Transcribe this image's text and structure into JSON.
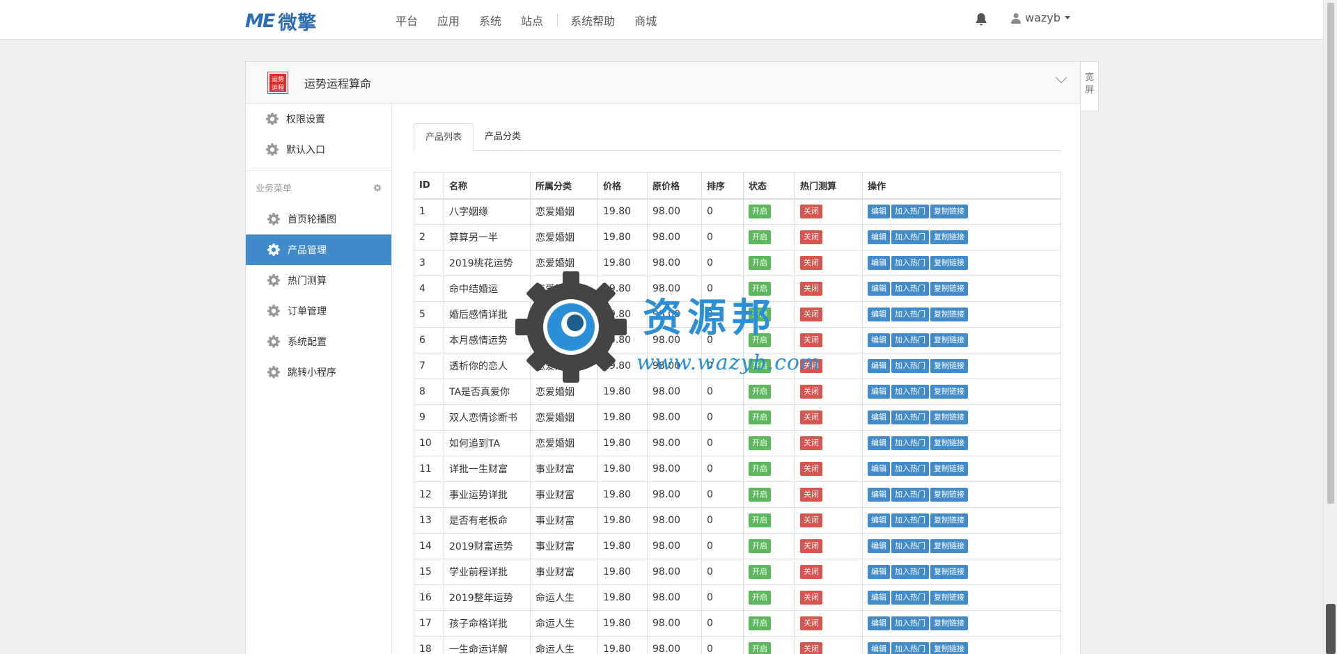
{
  "brand": {
    "mark": "ME",
    "name": "微擎"
  },
  "nav": [
    "平台",
    "应用",
    "系统",
    "站点",
    "系统帮助",
    "商城"
  ],
  "user": {
    "name": "wazyb"
  },
  "app": {
    "title": "运势运程算命",
    "icon_text": "运势运程",
    "wide_label": "宽屏"
  },
  "sidebar": {
    "top_items": [
      "权限设置",
      "默认入口"
    ],
    "group_label": "业务菜单",
    "items": [
      "首页轮播图",
      "产品管理",
      "热门测算",
      "订单管理",
      "系统配置",
      "跳转小程序"
    ],
    "active": "产品管理"
  },
  "tabs": [
    "产品列表",
    "产品分类"
  ],
  "table": {
    "headers": [
      "ID",
      "名称",
      "所属分类",
      "价格",
      "原价格",
      "排序",
      "状态",
      "热门测算",
      "操作"
    ],
    "status_label": "开启",
    "hot_label": "关闭",
    "actions": [
      "编辑",
      "加入热门",
      "复制链接"
    ],
    "rows": [
      [
        "1",
        "八字姻缘",
        "恋爱婚姻",
        "19.80",
        "98.00",
        "0"
      ],
      [
        "2",
        "算算另一半",
        "恋爱婚姻",
        "19.80",
        "98.00",
        "0"
      ],
      [
        "3",
        "2019桃花运势",
        "恋爱婚姻",
        "19.80",
        "98.00",
        "0"
      ],
      [
        "4",
        "命中结婚运",
        "恋爱婚姻",
        "19.80",
        "98.00",
        "0"
      ],
      [
        "5",
        "婚后感情详批",
        "恋爱婚姻",
        "19.80",
        "98.00",
        "0"
      ],
      [
        "6",
        "本月感情运势",
        "恋爱婚姻",
        "19.80",
        "98.00",
        "0"
      ],
      [
        "7",
        "透析你的恋人",
        "恋爱婚姻",
        "19.80",
        "98.00",
        "0"
      ],
      [
        "8",
        "TA是否真爱你",
        "恋爱婚姻",
        "19.80",
        "98.00",
        "0"
      ],
      [
        "9",
        "双人恋情诊断书",
        "恋爱婚姻",
        "19.80",
        "98.00",
        "0"
      ],
      [
        "10",
        "如何追到TA",
        "恋爱婚姻",
        "19.80",
        "98.00",
        "0"
      ],
      [
        "11",
        "详批一生财富",
        "事业财富",
        "19.80",
        "98.00",
        "0"
      ],
      [
        "12",
        "事业运势详批",
        "事业财富",
        "19.80",
        "98.00",
        "0"
      ],
      [
        "13",
        "是否有老板命",
        "事业财富",
        "19.80",
        "98.00",
        "0"
      ],
      [
        "14",
        "2019财富运势",
        "事业财富",
        "19.80",
        "98.00",
        "0"
      ],
      [
        "15",
        "学业前程详批",
        "事业财富",
        "19.80",
        "98.00",
        "0"
      ],
      [
        "16",
        "2019整年运势",
        "命运人生",
        "19.80",
        "98.00",
        "0"
      ],
      [
        "17",
        "孩子命格详批",
        "命运人生",
        "19.80",
        "98.00",
        "0"
      ],
      [
        "18",
        "一生命运详解",
        "命运人生",
        "19.80",
        "98.00",
        "0"
      ]
    ]
  },
  "watermark": {
    "text": "资源邦",
    "url": "www.wazyb.com"
  },
  "colors": {
    "primary": "#428bca",
    "success": "#5cb85c",
    "danger": "#d9534f",
    "brand": "#2a6db5"
  }
}
